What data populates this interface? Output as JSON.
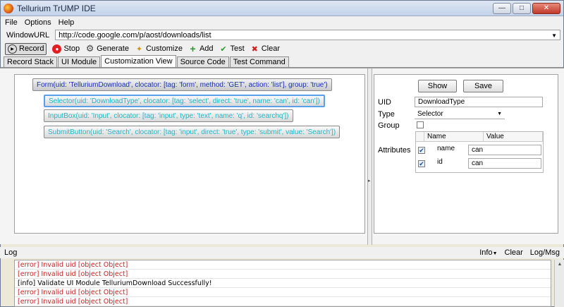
{
  "window": {
    "title": "Tellurium TrUMP IDE"
  },
  "menu": [
    "File",
    "Options",
    "Help"
  ],
  "url_bar": {
    "label": "WindowURL",
    "value": "http://code.google.com/p/aost/downloads/list"
  },
  "toolbar": {
    "record": "Record",
    "stop": "Stop",
    "generate": "Generate",
    "customize": "Customize",
    "add": "Add",
    "test": "Test",
    "clear": "Clear"
  },
  "tabs": [
    "Record Stack",
    "UI Module",
    "Customization View",
    "Source Code",
    "Test Command"
  ],
  "active_tab": "Customization View",
  "tree": {
    "form": "Form(uid: 'TelluriumDownload', clocator: [tag: 'form', method: 'GET', action: 'list'], group: 'true')",
    "children": [
      "Selector(uid: 'DownloadType', clocator: [tag: 'select', direct: 'true', name: 'can', id: 'can'])",
      "InputBox(uid: 'Input', clocator: [tag: 'input', type: 'text', name: 'q', id: 'searchq'])",
      "SubmitButton(uid: 'Search', clocator: [tag: 'input', direct: 'true', type: 'submit', value: 'Search'])"
    ]
  },
  "properties": {
    "show_button": "Show",
    "save_button": "Save",
    "uid_label": "UID",
    "uid_value": "DownloadType",
    "type_label": "Type",
    "type_value": "Selector",
    "group_label": "Group",
    "attributes_label": "Attributes",
    "attr_headers": [
      "Name",
      "Value"
    ],
    "attributes": [
      {
        "name": "name",
        "value": "can"
      },
      {
        "name": "id",
        "value": "can"
      }
    ]
  },
  "log": {
    "label": "Log",
    "info_menu": "Info",
    "clear": "Clear",
    "log_msg": "Log/Msg",
    "lines": [
      {
        "kind": "error",
        "text": "[error] Invalid uid [object Object]"
      },
      {
        "kind": "error",
        "text": "[error] Invalid uid [object Object]"
      },
      {
        "kind": "info",
        "text": "[info] Validate UI Module TelluriumDownload Successfully!"
      },
      {
        "kind": "error",
        "text": "[error] Invalid uid [object Object]"
      },
      {
        "kind": "error",
        "text": "[error] Invalid uid [object Object]"
      }
    ]
  }
}
